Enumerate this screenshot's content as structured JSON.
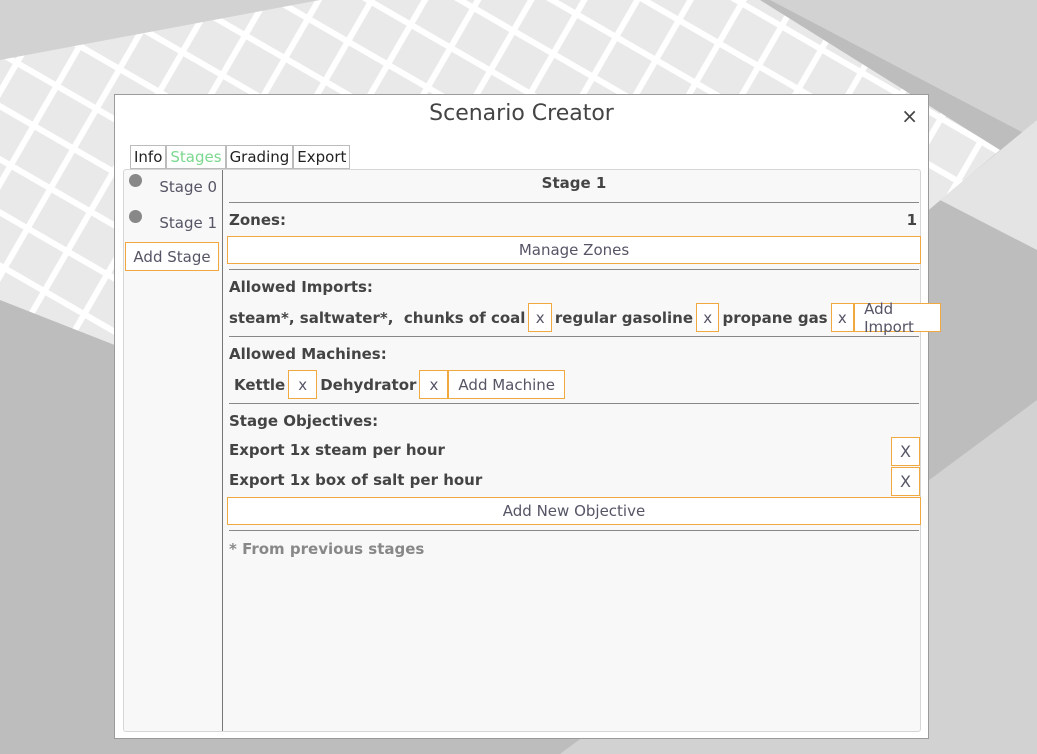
{
  "dialog": {
    "title": "Scenario Creator",
    "close_glyph": "×"
  },
  "tabs": [
    {
      "label": "Info",
      "active": false
    },
    {
      "label": "Stages",
      "active": true
    },
    {
      "label": "Grading",
      "active": false
    },
    {
      "label": "Export",
      "active": false
    }
  ],
  "sidebar": {
    "stages": [
      {
        "label": "Stage 0"
      },
      {
        "label": "Stage 1"
      }
    ],
    "add_stage_label": "Add Stage"
  },
  "stage": {
    "title": "Stage 1",
    "zones_label": "Zones:",
    "zones_count": "1",
    "manage_zones_label": "Manage Zones",
    "imports_label": "Allowed Imports:",
    "inherited_imports": "steam*, saltwater*,  ",
    "imports": [
      "chunks of coal",
      "regular gasoline",
      "propane gas"
    ],
    "add_import_label": "Add Import",
    "machines_label": "Allowed Machines:",
    "machines": [
      "Kettle",
      "Dehydrator"
    ],
    "add_machine_label": "Add Machine",
    "objectives_label": "Stage Objectives:",
    "objectives": [
      "Export 1x steam per hour",
      "Export 1x box of salt per hour"
    ],
    "objective_remove_label": "X",
    "remove_label": "x",
    "add_objective_label": "Add New Objective",
    "footnote": "* From previous stages"
  },
  "colors": {
    "accent_border": "#f0a840",
    "active_tab": "#7bd88f",
    "stage_dot": "#888888"
  }
}
